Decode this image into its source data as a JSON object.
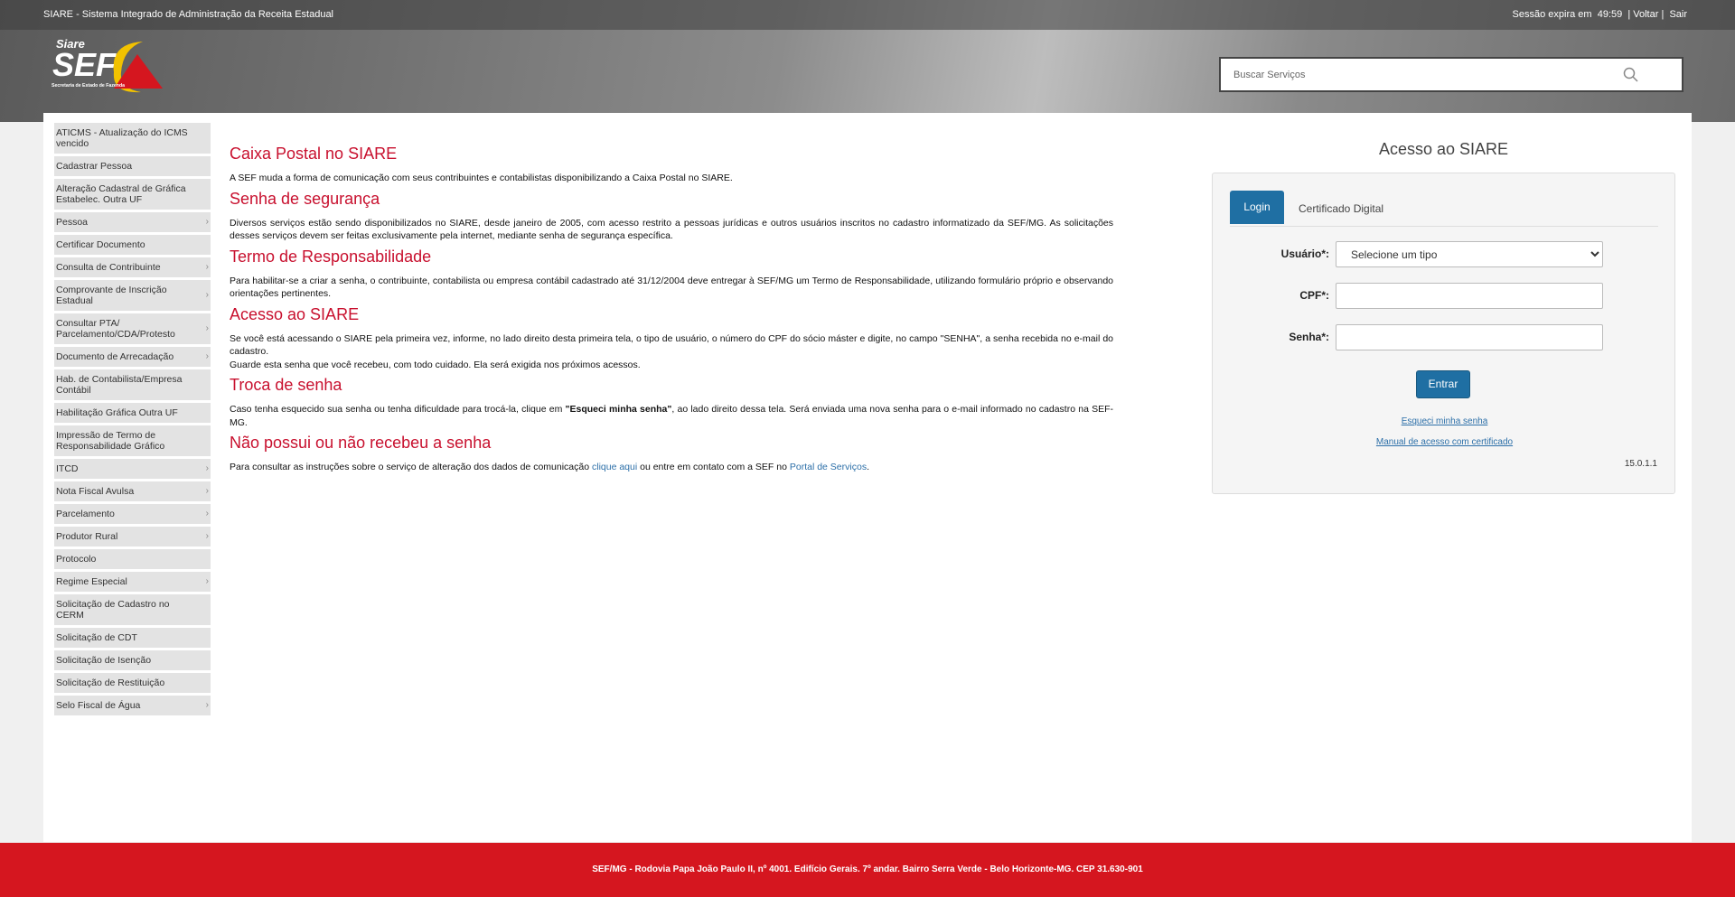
{
  "topbar": {
    "system_title": "SIARE - Sistema Integrado de Administração da Receita Estadual",
    "session_label": "Sessão expira em",
    "session_time": "49:59",
    "back_link": "Voltar",
    "logout_link": "Sair"
  },
  "logo": {
    "top_text": "Siare",
    "main_text": "SEF",
    "subtitle": "Secretaria de Estado de Fazenda"
  },
  "search": {
    "placeholder": "Buscar Serviços",
    "value": ""
  },
  "sidebar": {
    "items": [
      {
        "label": "ATICMS - Atualização do ICMS vencido",
        "has_submenu": false
      },
      {
        "label": "Cadastrar Pessoa",
        "has_submenu": false
      },
      {
        "label": "Alteração Cadastral de Gráfica Estabelec. Outra UF",
        "has_submenu": false
      },
      {
        "label": "Pessoa",
        "has_submenu": true
      },
      {
        "label": "Certificar Documento",
        "has_submenu": false
      },
      {
        "label": "Consulta de Contribuinte",
        "has_submenu": true
      },
      {
        "label": "Comprovante de Inscrição Estadual",
        "has_submenu": true
      },
      {
        "label": "Consultar PTA/ Parcelamento/CDA/Protesto",
        "has_submenu": true
      },
      {
        "label": "Documento de Arrecadação",
        "has_submenu": true
      },
      {
        "label": "Hab. de Contabilista/Empresa Contábil",
        "has_submenu": false
      },
      {
        "label": "Habilitação Gráfica Outra UF",
        "has_submenu": false
      },
      {
        "label": "Impressão de Termo de Responsabilidade Gráfico",
        "has_submenu": false
      },
      {
        "label": "ITCD",
        "has_submenu": true
      },
      {
        "label": "Nota Fiscal Avulsa",
        "has_submenu": true
      },
      {
        "label": "Parcelamento",
        "has_submenu": true
      },
      {
        "label": "Produtor Rural",
        "has_submenu": true
      },
      {
        "label": "Protocolo",
        "has_submenu": false
      },
      {
        "label": "Regime Especial",
        "has_submenu": true
      },
      {
        "label": "Solicitação de Cadastro no CERM",
        "has_submenu": false
      },
      {
        "label": "Solicitação de CDT",
        "has_submenu": false
      },
      {
        "label": "Solicitação de Isenção",
        "has_submenu": false
      },
      {
        "label": "Solicitação de Restituição",
        "has_submenu": false
      },
      {
        "label": "Selo Fiscal de Água",
        "has_submenu": true
      }
    ]
  },
  "content": {
    "s1_title": "Caixa Postal no SIARE",
    "s1_text": "A SEF muda a forma de comunicação com seus contribuintes e contabilistas disponibilizando a Caixa Postal no SIARE.",
    "s2_title": "Senha de segurança",
    "s2_text": "Diversos serviços estão sendo disponibilizados no SIARE, desde janeiro de 2005, com acesso restrito a pessoas jurídicas e outros usuários inscritos no cadastro informatizado da SEF/MG. As solicitações desses serviços devem ser feitas exclusivamente pela internet, mediante senha de segurança específica.",
    "s3_title": "Termo de Responsabilidade",
    "s3_text": "Para habilitar-se a criar a senha, o contribuinte, contabilista ou empresa contábil cadastrado até 31/12/2004 deve entregar à SEF/MG um Termo de Responsabilidade, utilizando formulário próprio e observando orientações pertinentes.",
    "s4_title": "Acesso ao SIARE",
    "s4_text1": "Se você está acessando o SIARE pela primeira vez, informe, no lado direito desta primeira tela, o tipo de usuário, o número do CPF do sócio máster e digite, no campo \"SENHA\", a senha recebida no e-mail do cadastro.",
    "s4_text2": "Guarde esta senha que você recebeu, com todo cuidado. Ela será exigida nos próximos acessos.",
    "s5_title": "Troca de senha",
    "s5_text_before": "Caso tenha esquecido sua senha ou tenha dificuldade para trocá-la, clique em ",
    "s5_text_bold": "\"Esqueci minha senha\"",
    "s5_text_after": ", ao lado direito dessa tela. Será enviada uma nova senha para o e-mail informado no cadastro na SEF-MG.",
    "s6_title": "Não possui ou não recebeu a senha",
    "s6_text_before": "Para consultar as instruções sobre o serviço de alteração dos dados de comunicação ",
    "s6_link1": "clique aqui",
    "s6_text_middle": " ou entre em contato com a SEF no ",
    "s6_link2": "Portal de Serviços",
    "s6_text_after": "."
  },
  "login": {
    "title": "Acesso ao SIARE",
    "tab_login": "Login",
    "tab_cert": "Certificado Digital",
    "user_label": "Usuário*:",
    "user_select_value": "Selecione um tipo",
    "cpf_label": "CPF*:",
    "cpf_value": "",
    "password_label": "Senha*:",
    "password_value": "",
    "submit_label": "Entrar",
    "forgot_link": "Esqueci minha senha",
    "manual_link": "Manual de acesso com certificado",
    "version": "15.0.1.1"
  },
  "footer": {
    "address": "SEF/MG - Rodovia Papa João Paulo II, nº 4001. Edifício Gerais.  7º andar.  Bairro Serra Verde - Belo Horizonte-MG. CEP 31.630-901"
  },
  "colors": {
    "brand_red": "#d5161f",
    "heading_red": "#c8102e",
    "accent_blue": "#1f6fa3"
  }
}
